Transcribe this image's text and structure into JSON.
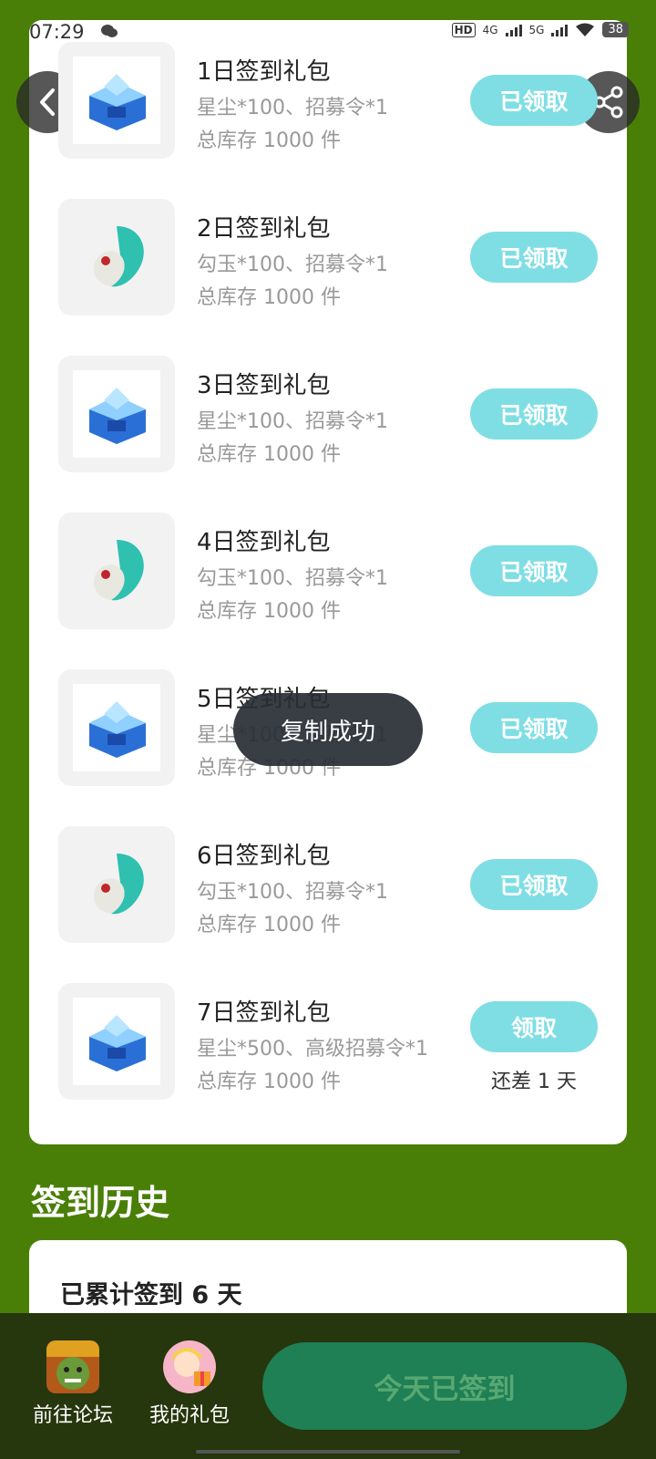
{
  "status_bar": {
    "time": "07:29",
    "battery": "38",
    "network_1": "4G",
    "network_2": "5G",
    "hd": "HD"
  },
  "gifts": [
    {
      "title": "1日签到礼包",
      "desc": "星尘*100、招募令*1",
      "stock": "总库存 1000 件",
      "button": "已领取",
      "icon": "crystal-chest-icon"
    },
    {
      "title": "2日签到礼包",
      "desc": "勾玉*100、招募令*1",
      "stock": "总库存 1000 件",
      "button": "已领取",
      "icon": "jade-magatama-icon"
    },
    {
      "title": "3日签到礼包",
      "desc": "星尘*100、招募令*1",
      "stock": "总库存 1000 件",
      "button": "已领取",
      "icon": "crystal-chest-icon"
    },
    {
      "title": "4日签到礼包",
      "desc": "勾玉*100、招募令*1",
      "stock": "总库存 1000 件",
      "button": "已领取",
      "icon": "jade-magatama-icon"
    },
    {
      "title": "5日签到礼包",
      "desc": "星尘*100、招募令*1",
      "stock": "总库存 1000 件",
      "button": "已领取",
      "icon": "crystal-chest-icon"
    },
    {
      "title": "6日签到礼包",
      "desc": "勾玉*100、招募令*1",
      "stock": "总库存 1000 件",
      "button": "已领取",
      "icon": "jade-magatama-icon"
    },
    {
      "title": "7日签到礼包",
      "desc": "星尘*500、高级招募令*1",
      "stock": "总库存 1000 件",
      "button": "领取",
      "note": "还差 1 天",
      "icon": "crystal-chest-icon"
    }
  ],
  "toast": "复制成功",
  "history": {
    "title": "签到历史",
    "summary": "已累计签到 6 天"
  },
  "bottom_nav": {
    "forum_label": "前往论坛",
    "gifts_label": "我的礼包",
    "sign_button": "今天已签到"
  },
  "colors": {
    "background": "#4a7f07",
    "claimed_button": "#7fdee3",
    "sign_button": "#1f7f55",
    "bottom_bar": "#26360d"
  }
}
